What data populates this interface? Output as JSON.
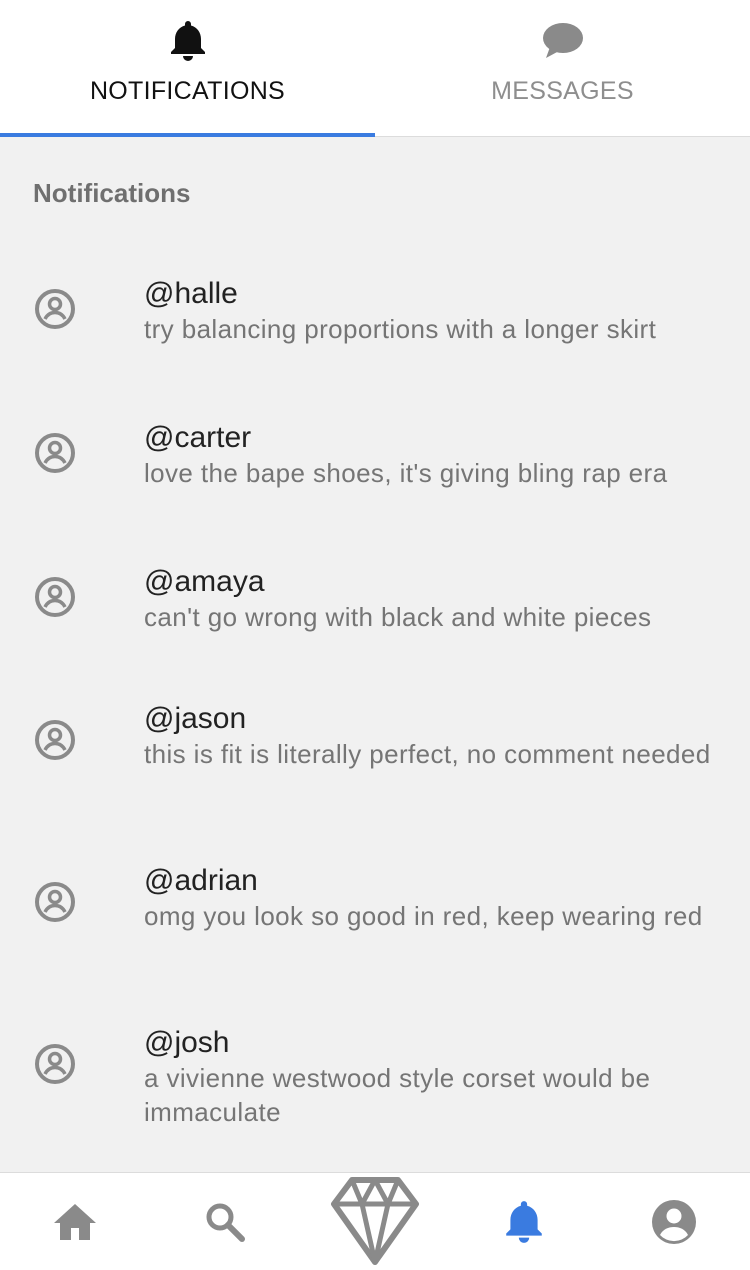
{
  "tabs": [
    {
      "label": "NOTIFICATIONS",
      "icon": "bell-icon",
      "active": true
    },
    {
      "label": "MESSAGES",
      "icon": "chat-bubble-icon",
      "active": false
    }
  ],
  "section_title": "Notifications",
  "notifications": [
    {
      "handle": "@halle",
      "message": "try balancing proportions with a longer skirt"
    },
    {
      "handle": "@carter",
      "message": "love the bape shoes, it's giving bling rap era"
    },
    {
      "handle": "@amaya",
      "message": "can't go wrong with black and white pieces"
    },
    {
      "handle": "@jason",
      "message": "this is fit is literally perfect, no comment needed"
    },
    {
      "handle": "@adrian",
      "message": "omg you look so good in red, keep wearing red"
    },
    {
      "handle": "@josh",
      "message": "a vivienne westwood style corset would be immaculate"
    }
  ],
  "bottom_nav": [
    {
      "icon": "home-icon",
      "active": false
    },
    {
      "icon": "search-icon",
      "active": false
    },
    {
      "icon": "diamond-icon",
      "active": false
    },
    {
      "icon": "bell-icon",
      "active": true
    },
    {
      "icon": "account-icon",
      "active": false
    }
  ],
  "colors": {
    "accent": "#3a7be0",
    "icon_gray": "#8a8a8a",
    "background": "#f1f1f1"
  }
}
